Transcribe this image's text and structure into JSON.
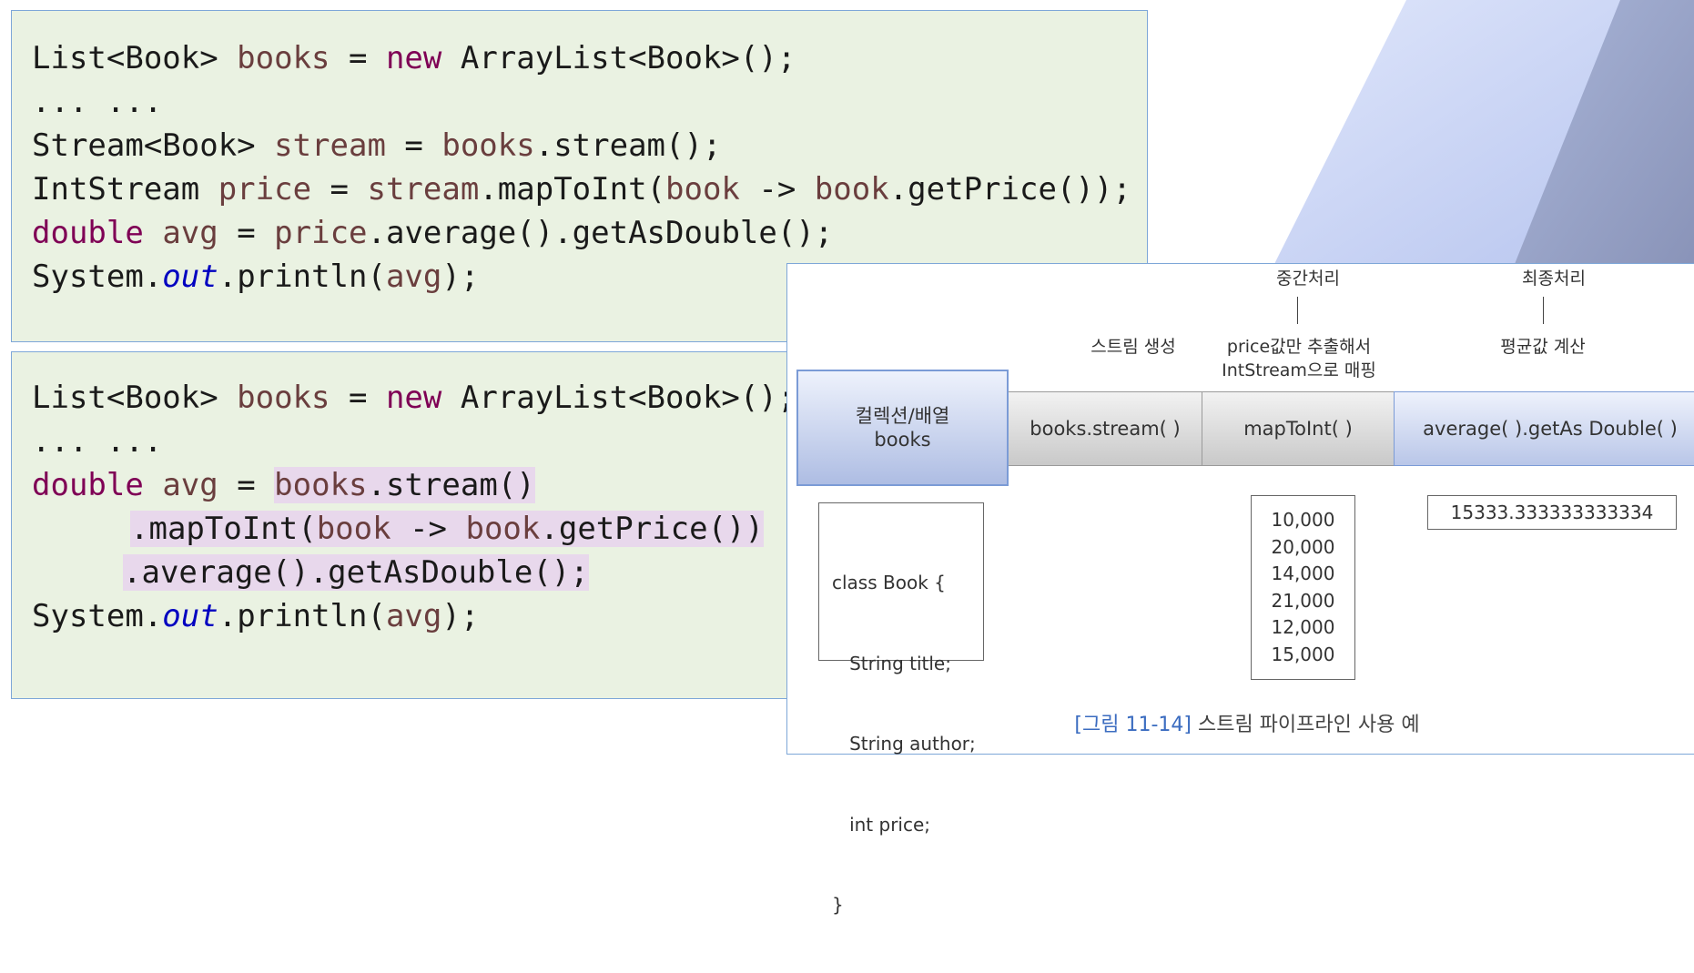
{
  "code_top": {
    "line1": [
      "List<Book> ",
      "books",
      " = ",
      "new",
      " ArrayList<Book>();"
    ],
    "line2": "... ...",
    "line3": [
      "Stream<Book> ",
      "stream",
      " = ",
      "books",
      ".stream();"
    ],
    "line4": [
      "IntStream ",
      "price",
      " = ",
      "stream",
      ".mapToInt(",
      "book",
      " -> ",
      "book",
      ".getPrice());"
    ],
    "line5": [
      "double",
      " ",
      "avg",
      " = ",
      "price",
      ".average().getAsDouble();"
    ],
    "line6": [
      "System.",
      "out",
      ".println(",
      "avg",
      ");"
    ]
  },
  "code_bottom": {
    "line1": [
      "List<Book> ",
      "books",
      " = ",
      "new",
      " ArrayList<Book>();"
    ],
    "line2": "... ...",
    "line3": [
      "double",
      " ",
      "avg",
      " = ",
      "books",
      ".stream()"
    ],
    "line4": [
      ".mapToInt(",
      "book",
      " -> ",
      "book",
      ".getPrice())"
    ],
    "line5": ".average().getAsDouble();",
    "line6": [
      "System.",
      "out",
      ".println(",
      "avg",
      ");"
    ]
  },
  "figure": {
    "top_label_intermediate": "중간처리",
    "top_label_final": "최종처리",
    "label_stream_create": "스트림 생성",
    "label_map_line1": "price값만 추출해서",
    "label_map_line2": "IntStream으로 매핑",
    "label_average": "평균값 계산",
    "source_line1": "컬렉션/배열",
    "source_line2": "books",
    "stage_stream": "books.stream( )",
    "stage_map": "mapToInt( )",
    "stage_average": "average( ).getAs Double( )",
    "class_lines": [
      "class Book {",
      "   String title;",
      "   String author;",
      "   int price;",
      "}"
    ],
    "prices": [
      "10,000",
      "20,000",
      "14,000",
      "21,000",
      "12,000",
      "15,000"
    ],
    "result": "15333.333333333334",
    "caption_num": "[그림 11-14]",
    "caption_text": " 스트림 파이프라인 사용 예"
  },
  "colors": {
    "keyword": "#7f0055",
    "variable": "#6a3e3e",
    "static_field": "#0000c0",
    "code_bg": "#eaf2e2",
    "highlight": "#e8d8ec",
    "caption_accent": "#3b6cc0"
  }
}
